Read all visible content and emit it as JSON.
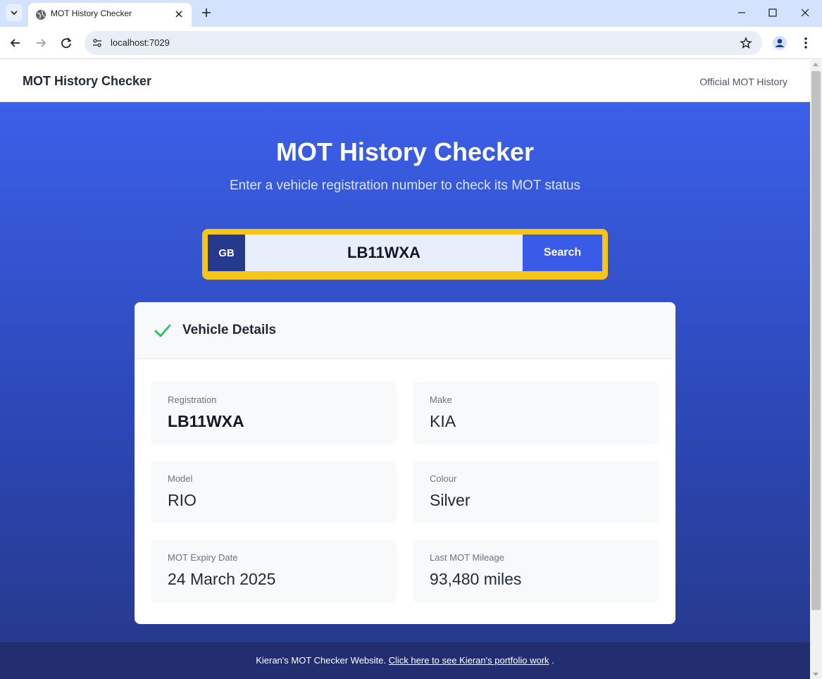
{
  "browser": {
    "tab_title": "MOT History Checker",
    "url": "localhost:7029"
  },
  "header": {
    "brand": "MOT History Checker",
    "link": "Official MOT History"
  },
  "hero": {
    "title": "MOT History Checker",
    "subtitle": "Enter a vehicle registration number to check its MOT status"
  },
  "search": {
    "country": "GB",
    "value": "LB11WXA",
    "button": "Search"
  },
  "vehicle": {
    "title": "Vehicle Details",
    "fields": [
      {
        "label": "Registration",
        "value": "LB11WXA"
      },
      {
        "label": "Make",
        "value": "KIA"
      },
      {
        "label": "Model",
        "value": "RIO"
      },
      {
        "label": "Colour",
        "value": "Silver"
      },
      {
        "label": "MOT Expiry Date",
        "value": "24 March 2025"
      },
      {
        "label": "Last MOT Mileage",
        "value": "93,480 miles"
      }
    ]
  },
  "footer": {
    "text": "Kieran's MOT Checker Website.",
    "link": "Click here to see Kieran's portfolio work",
    "end": "."
  },
  "colors": {
    "accent": "#3a5be7",
    "plate_yellow": "#f5c518",
    "gb_blue": "#253a8f",
    "success": "#22c55e"
  }
}
